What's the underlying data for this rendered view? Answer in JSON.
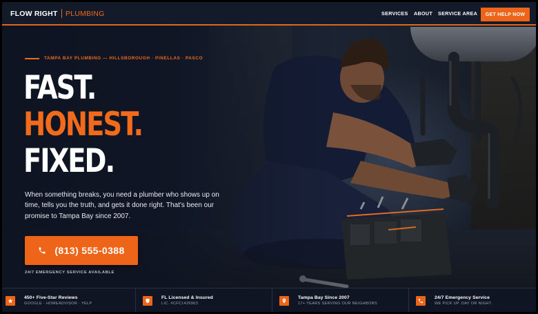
{
  "brand": {
    "name_part1": "FLOW RIGHT",
    "name_part2": "PLUMBING",
    "accent_color": "#ee6418"
  },
  "nav": {
    "items": [
      "SERVICES",
      "ABOUT",
      "SERVICE AREA"
    ],
    "cta": "GET HELP NOW"
  },
  "hero": {
    "eyebrow": "TAMPA BAY PLUMBING — HILLSBOROUGH · PINELLAS · PASCO",
    "headline": [
      "FAST.",
      "HONEST.",
      "FIXED."
    ],
    "lede": "When something breaks, you need a plumber who shows up on time, tells you the truth, and gets it done right. That's been our promise to Tampa Bay since 2007.",
    "phone_button": "(813) 555-0388",
    "phone_icon": "phone-icon",
    "note": "24/7 EMERGENCY SERVICE AVAILABLE"
  },
  "trust": [
    {
      "icon": "star-icon",
      "title": "450+ Five-Star Reviews",
      "subtitle": "GOOGLE · HOMEADVISOR · YELP"
    },
    {
      "icon": "shield-icon",
      "title": "FL Licensed & Insured",
      "subtitle": "LIC. #CFC1426963"
    },
    {
      "icon": "location-pin-icon",
      "title": "Tampa Bay Since 2007",
      "subtitle": "17+ YEARS SERVING OUR NEIGHBORS"
    },
    {
      "icon": "phone-icon",
      "title": "24/7 Emergency Service",
      "subtitle": "WE PICK UP. DAY OR NIGHT."
    }
  ]
}
